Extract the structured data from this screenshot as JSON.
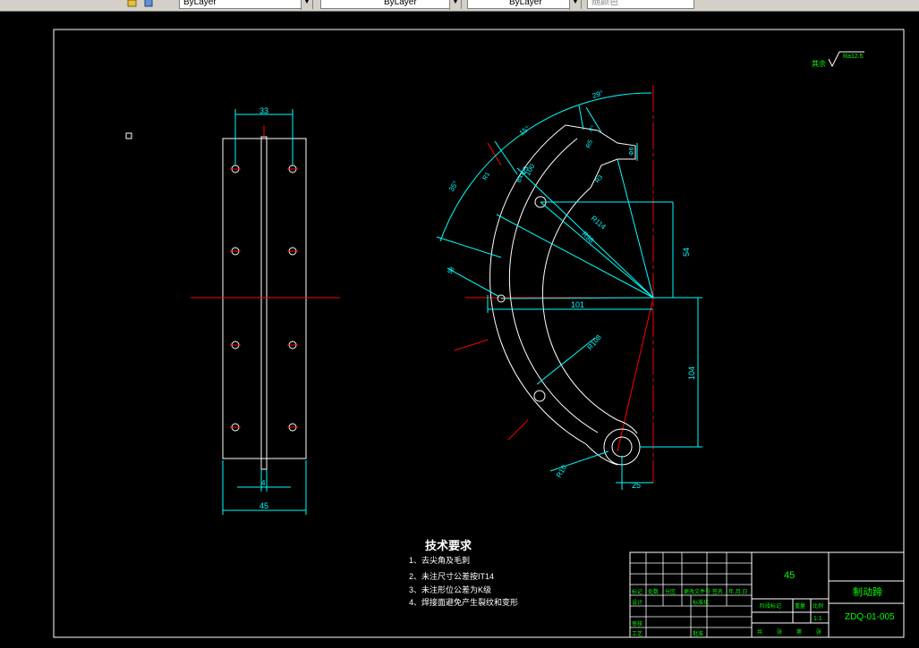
{
  "toolbar": {
    "layer_color": "ByLayer",
    "layer_linetype": "ByLayer",
    "layer_lineweight": "ByLayer",
    "plot_style": "随颜色"
  },
  "colors": {
    "background": "#000000",
    "outline": "#ffffff",
    "centerline": "#ff0000",
    "dimension": "#00ffff",
    "text": "#00ff00"
  },
  "roughness": {
    "prefix": "其余",
    "value": "Ra12.5"
  },
  "dimensions": {
    "width_top": "33",
    "width_bottom": "45",
    "slot": "4",
    "arc_angle_1": "29°",
    "arc_angle_2": "15°",
    "arc_angle_3": "35°",
    "arc_angle_small": "4°",
    "radius_r": "R5",
    "hole_dia": "Φ6",
    "notch": "R3",
    "radius_100": "100",
    "hole_callout": "8×Φ5",
    "radius_114": "R114",
    "radius_98": "R98",
    "vertical_54": "54",
    "horizontal_101": "101",
    "radius_108": "R108",
    "vertical_104": "104",
    "pin_radius": "R10",
    "pin_offset": "25",
    "small_r": "R1",
    "angle_58": "58"
  },
  "notes": {
    "title": "技术要求",
    "items": [
      "1、去尖角及毛刺",
      "2、未注尺寸公差按IT14",
      "3、未注形位公差为K级",
      "4、焊接面避免产生裂纹和变形"
    ]
  },
  "title_block": {
    "material": "45",
    "part_name": "制动蹄",
    "drawing_number": "ZDQ-01-005",
    "scale": "1:1",
    "headers": [
      "标记",
      "处数",
      "分区",
      "更改文件号",
      "签名",
      "年.月.日"
    ],
    "role_design": "设计",
    "role_standard": "标准化",
    "role_review": "审核",
    "role_process": "工艺",
    "role_approve": "批准",
    "stage": "阶段标记",
    "weight": "重量",
    "ratio": "比例",
    "sheets": [
      "共",
      "张",
      "第",
      "张"
    ]
  }
}
